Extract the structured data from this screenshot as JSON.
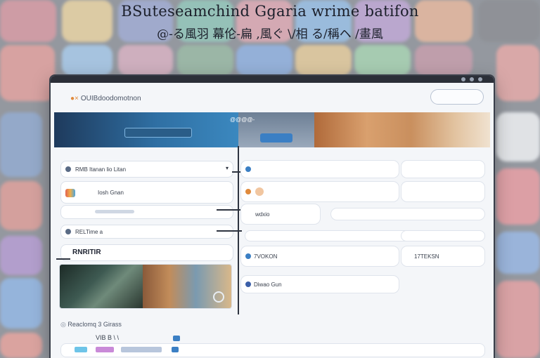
{
  "header": {
    "title_line_1": "BSuteseamchind Ggaria wrime batifon",
    "title_line_2": "@-る風羽 幕伦-扁 ,風ぐ \\/相 る/稱ヘ /畫風"
  },
  "app": {
    "brand": "OUIBdoodomotnon"
  },
  "banner": {
    "mid_text": "@@@@-"
  },
  "left_panel": {
    "rows": [
      {
        "label": "RMB Itanan lio Litan"
      },
      {
        "label": "Iosh Gnan"
      },
      {
        "label": ""
      },
      {
        "label": "RELTime a"
      },
      {
        "label": "RNRITIR"
      }
    ]
  },
  "right_panel": {
    "rows": [
      {
        "label": ""
      },
      {
        "label": ""
      },
      {
        "label": "wdxio"
      },
      {
        "label": ""
      },
      {
        "label": "7VOKON"
      },
      {
        "label": "Diwao Gun"
      }
    ],
    "side_values": [
      {
        "label": ""
      },
      {
        "label": ""
      },
      {
        "label": ""
      },
      {
        "label": ""
      },
      {
        "label": "17TEKSN"
      }
    ]
  },
  "section": {
    "title": "Reaclomq 3 Girass",
    "sub_label": "VIB B \\  \\"
  },
  "colors": {
    "accent_blue": "#3b7fc4",
    "accent_orange": "#e08a3c",
    "window_bg": "#f4f6f9"
  }
}
